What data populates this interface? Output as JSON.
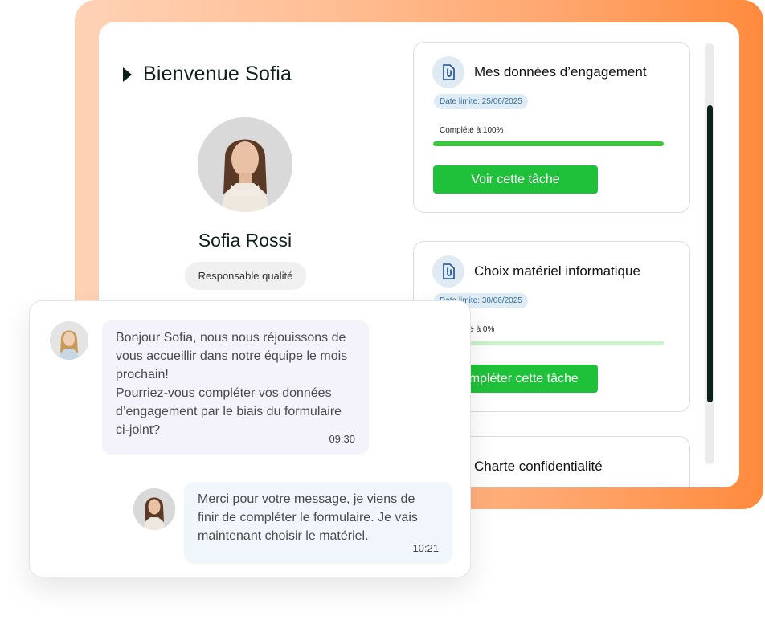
{
  "profile": {
    "welcome": "Bienvenue Sofia",
    "name": "Sofia Rossi",
    "role": "Responsable qualité"
  },
  "tasks": [
    {
      "title": "Mes données d’engagement",
      "deadline": "Date limite: 25/06/2025",
      "progress_label": "Complété à 100%",
      "progress": 1.0,
      "button": "Voir cette tâche"
    },
    {
      "title": "Choix matériel informatique",
      "deadline": "Date limite: 30/06/2025",
      "progress_label": "Complété à 0%",
      "progress": 0.0,
      "button": "Compléter cette tâche"
    },
    {
      "title": "Charte confidentialité"
    }
  ],
  "chat": {
    "messages": [
      {
        "text": "Bonjour Sofia, nous nous réjouissons de vous accueillir dans notre équipe le mois prochain!\nPourriez-vous compléter vos données d’engagement par le biais du formulaire ci-joint?",
        "time": "09:30"
      },
      {
        "text": "Merci pour votre message, je viens de finir de compléter le formulaire. Je vais maintenant choisir le matériel.",
        "time": "10:21"
      }
    ]
  },
  "colors": {
    "accent_green": "#1fc13a",
    "progress_green": "#3cc83c",
    "frame_orange": "#ff8a3d",
    "dark": "#0c2119"
  },
  "icons": {
    "task": "document-paperclip-icon",
    "welcome": "caret-right-icon"
  }
}
